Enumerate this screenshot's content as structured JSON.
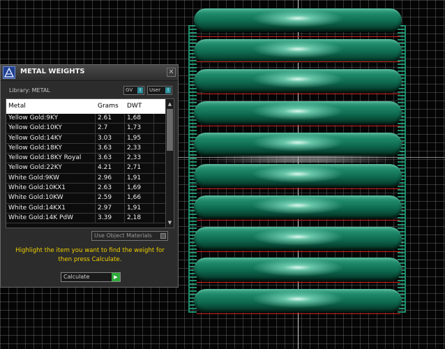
{
  "panel": {
    "title": "METAL WEIGHTS",
    "library_label": "Library: METAL",
    "gv_label": "GV",
    "user_label": "User",
    "columns": [
      "Metal",
      "Grams",
      "DWT"
    ],
    "rows": [
      {
        "metal": "Yellow Gold:9KY",
        "grams": "2.61",
        "dwt": "1,68"
      },
      {
        "metal": "Yellow Gold:10KY",
        "grams": "2.7",
        "dwt": "1,73"
      },
      {
        "metal": "Yellow Gold:14KY",
        "grams": "3.03",
        "dwt": "1,95"
      },
      {
        "metal": "Yellow Gold:18KY",
        "grams": "3.63",
        "dwt": "2,33"
      },
      {
        "metal": "Yellow Gold:18KY Royal",
        "grams": "3.63",
        "dwt": "2,33"
      },
      {
        "metal": "Yellow Gold:22KY",
        "grams": "4.21",
        "dwt": "2,71"
      },
      {
        "metal": "White Gold:9KW",
        "grams": "2.96",
        "dwt": "1,91"
      },
      {
        "metal": "White Gold:10KX1",
        "grams": "2.63",
        "dwt": "1,69"
      },
      {
        "metal": "White Gold:10KW",
        "grams": "2.59",
        "dwt": "1,66"
      },
      {
        "metal": "White Gold:14KX1",
        "grams": "2.97",
        "dwt": "1,91"
      },
      {
        "metal": "White Gold:14K PdW",
        "grams": "3.39",
        "dwt": "2,18"
      }
    ],
    "use_object_materials": "Use Object Materials",
    "instructions": "Highlight the item you want to find the weight for then press Calculate.",
    "calculate_label": "Calculate"
  },
  "colors": {
    "ring_green": "#1f8a6b",
    "instruction_yellow": "#f0d000",
    "grid": "#787878",
    "red_guide": "#d02020"
  },
  "icons": [
    "app-logo-icon",
    "close-icon",
    "scroll-up-icon",
    "scroll-down-icon",
    "calculate-go-icon"
  ]
}
